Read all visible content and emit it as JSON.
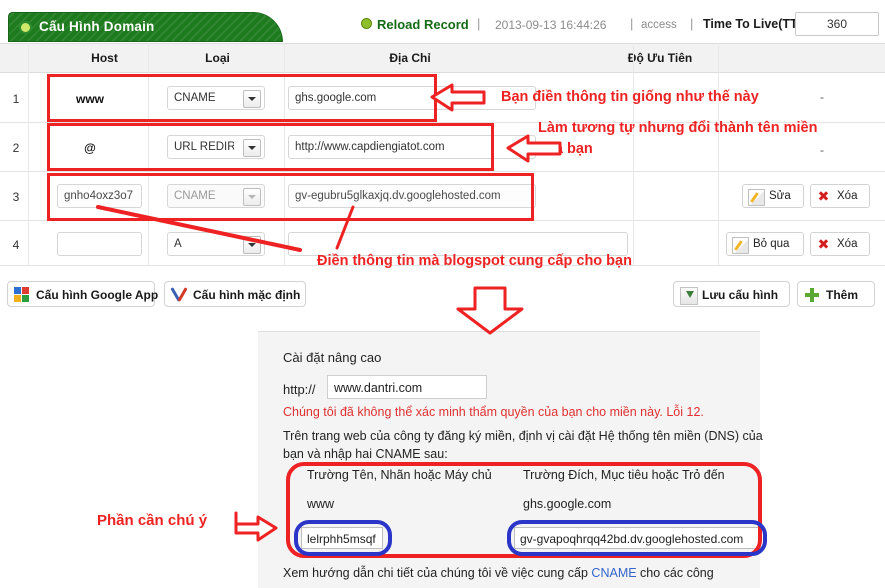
{
  "header": {
    "tab_title": "Cấu Hình Domain",
    "reload_label": "Reload Record",
    "separator": "|",
    "timestamp": "2013-09-13 16:44:26",
    "access_label": "access",
    "ttl_label": "Time To Live(TTL):",
    "ttl_value": "360",
    "accent_green": "#1d7a1d"
  },
  "table": {
    "columns": [
      "Host",
      "Loại",
      "Địa Chỉ",
      "Độ Ưu Tiên"
    ],
    "rows": [
      {
        "num": "1",
        "host": "www",
        "type": "CNAME",
        "address": "ghs.google.com",
        "priority": "-",
        "actions": []
      },
      {
        "num": "2",
        "host": "@",
        "type": "URL REDIREC",
        "address": "http://www.capdiengiatot.com",
        "priority": "-",
        "actions": []
      },
      {
        "num": "3",
        "host": "gnho4oxz3o7",
        "type": "CNAME",
        "address": "gv-egubru5glkaxjq.dv.googlehosted.com",
        "priority": "",
        "actions": [
          "Sửa",
          "Xóa"
        ]
      },
      {
        "num": "4",
        "host": "",
        "type": "A",
        "address": "",
        "priority": "",
        "actions": [
          "Bỏ qua",
          "Xóa"
        ]
      }
    ]
  },
  "toolbar": {
    "google_app": "Cấu hình Google App",
    "default_config": "Cấu hình mặc định",
    "save_config": "Lưu cấu hình",
    "add": "Thêm"
  },
  "panel": {
    "title": "Cài đặt nâng cao",
    "http_prefix": "http://",
    "domain_value": "www.dantri.com",
    "error_text": "Chúng tôi đã không thể xác minh thẩm quyền của bạn cho miền này. Lỗi 12.",
    "paragraph": "Trên trang web của công ty đăng ký miền, định vị cài đặt Hệ thống tên miền (DNS) của bạn và nhập hai CNAME sau:",
    "col_header_name": "Trường Tên, Nhãn hoặc Máy chủ",
    "col_header_dest": "Trường Đích, Mục tiêu hoặc Trỏ đến",
    "row1_name": "www",
    "row1_dest": "ghs.google.com",
    "row2_name": "lelrphh5msqf",
    "row2_dest": "gv-gvapoqhrqq42bd.dv.googlehosted.com",
    "footer_pre": "Xem hướng dẫn chi tiết của chúng tôi về việc cung cấp ",
    "footer_link": "CNAME",
    "footer_post": " cho các công",
    "link_color": "#3366cc"
  },
  "annotations": {
    "note1": "Bạn điền thông tin giống như thế này",
    "note2_line1": "Làm tương tự nhưng đổi thành tên miền",
    "note2_line2": "của bạn",
    "note3": "Điền thông tin mà blogspot cung cấp cho bạn",
    "note4": "Phần cần chú ý",
    "annotation_color": "#ee2222",
    "highlight_blue": "#2b35c8"
  }
}
